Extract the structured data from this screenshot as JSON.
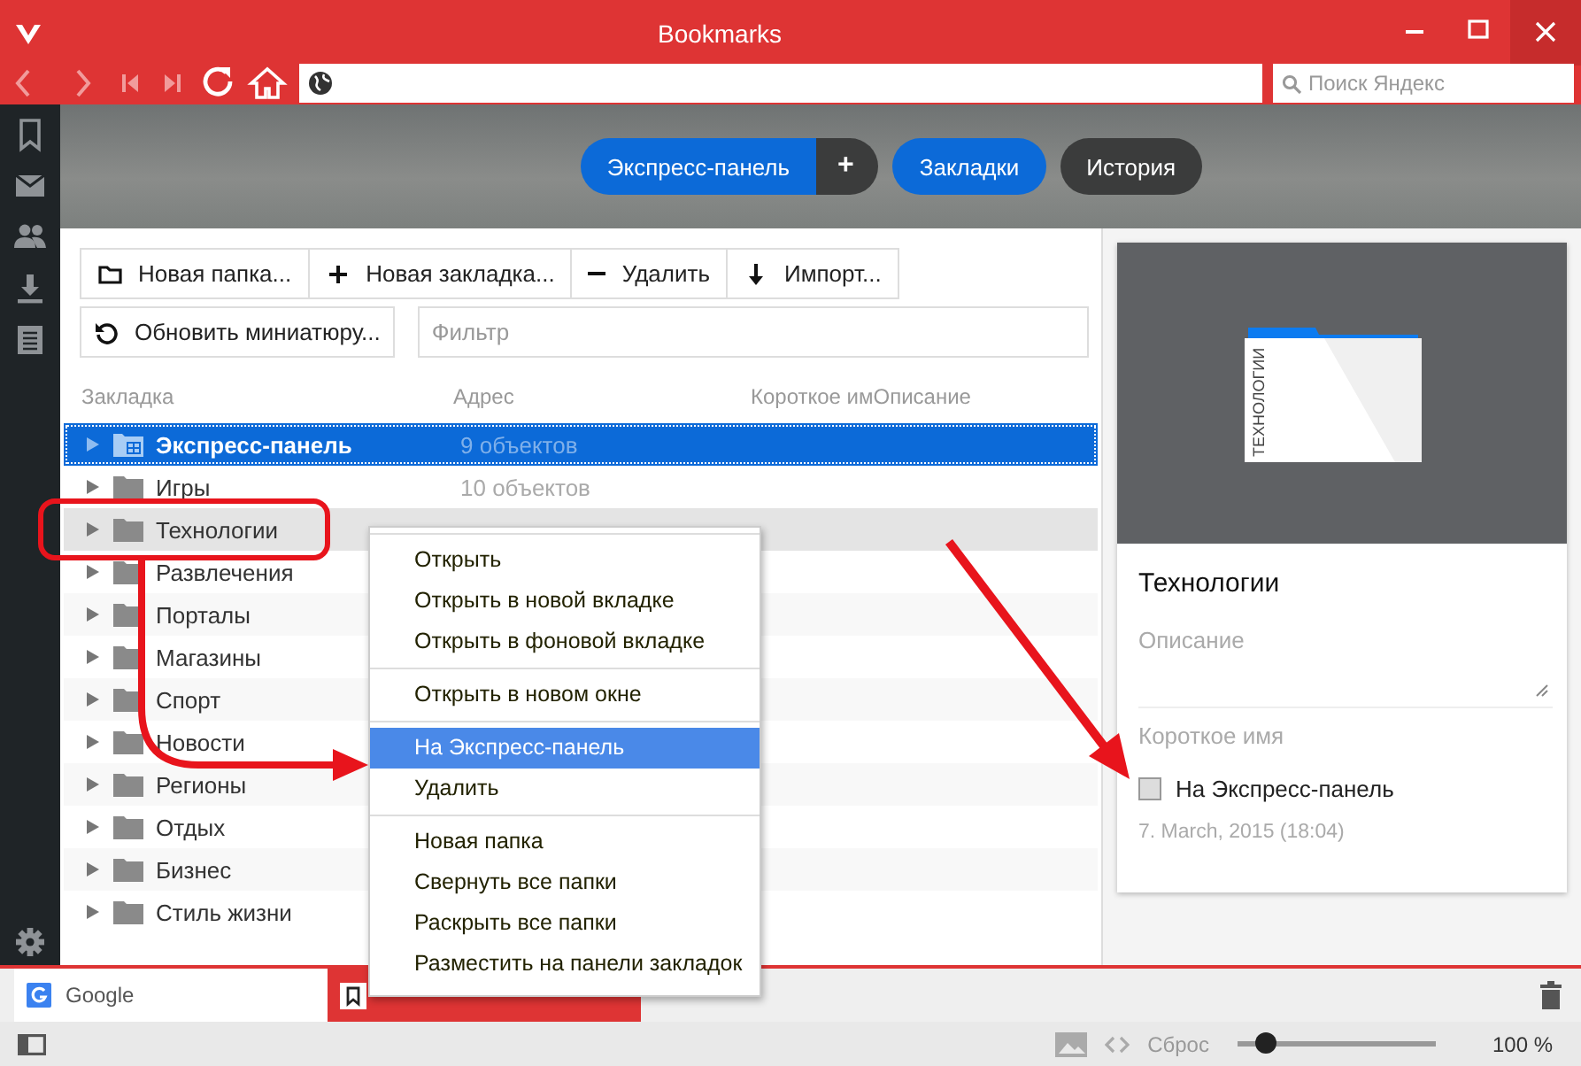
{
  "window": {
    "title": "Bookmarks"
  },
  "search": {
    "placeholder": "Поиск Яндекс"
  },
  "header_buttons": [
    {
      "label": "Экспресс-панель",
      "kind": "primary"
    },
    {
      "label": "+",
      "kind": "add"
    },
    {
      "label": "Закладки",
      "kind": "primary"
    },
    {
      "label": "История",
      "kind": "dark"
    }
  ],
  "toolbar": [
    {
      "label": "Новая папка...",
      "kind": "folder"
    },
    {
      "label": "Новая закладка...",
      "kind": "plus"
    },
    {
      "label": "Удалить",
      "kind": "minus"
    },
    {
      "label": "Импорт...",
      "kind": "import"
    }
  ],
  "refresh_button": {
    "label": "Обновить миниатюру..."
  },
  "filter": {
    "placeholder": "Фильтр"
  },
  "columns": [
    "Закладка",
    "Адрес",
    "Короткое им",
    "Описание"
  ],
  "rows": [
    {
      "name": "Экспресс-панель",
      "address": "9 объектов",
      "kind": "speeddial",
      "selected": true,
      "hovered": false
    },
    {
      "name": "Игры",
      "address": "10 объектов",
      "kind": "folder",
      "selected": false,
      "hovered": false
    },
    {
      "name": "Технологии",
      "kind": "folder",
      "selected": false,
      "hovered": true
    },
    {
      "name": "Развлечения",
      "kind": "folder",
      "selected": false,
      "hovered": false
    },
    {
      "name": "Порталы",
      "kind": "folder",
      "selected": false,
      "hovered": false
    },
    {
      "name": "Магазины",
      "kind": "folder",
      "selected": false,
      "hovered": false
    },
    {
      "name": "Спорт",
      "kind": "folder",
      "selected": false,
      "hovered": false
    },
    {
      "name": "Новости",
      "kind": "folder",
      "selected": false,
      "hovered": false
    },
    {
      "name": "Регионы",
      "kind": "folder",
      "selected": false,
      "hovered": false
    },
    {
      "name": "Отдых",
      "kind": "folder",
      "selected": false,
      "hovered": false
    },
    {
      "name": "Бизнес",
      "kind": "folder",
      "selected": false,
      "hovered": false
    },
    {
      "name": "Стиль жизни",
      "kind": "folder",
      "selected": false,
      "hovered": false
    }
  ],
  "context_menu": [
    {
      "items": [
        {
          "label": "Открыть",
          "selected": false
        },
        {
          "label": "Открыть в новой вкладке",
          "selected": false
        },
        {
          "label": "Открыть в фоновой вкладке",
          "selected": false
        }
      ]
    },
    {
      "items": [
        {
          "label": "Открыть в новом окне",
          "selected": false
        }
      ]
    },
    {
      "items": [
        {
          "label": "На Экспресс-панель",
          "selected": true
        },
        {
          "label": "Удалить",
          "selected": false
        }
      ]
    },
    {
      "items": [
        {
          "label": "Новая папка",
          "selected": false
        },
        {
          "label": "Свернуть все папки",
          "selected": false
        },
        {
          "label": "Раскрыть все папки",
          "selected": false
        },
        {
          "label": "Разместить на панели закладок",
          "selected": false
        }
      ]
    }
  ],
  "detail": {
    "thumbnail_label": "ТЕХНОЛОГИИ",
    "title": "Технологии",
    "description_placeholder": "Описание",
    "nickname_placeholder": "Короткое имя",
    "speed_dial": {
      "label": "На Экспресс-панель",
      "checked": false
    },
    "date": "7. March, 2015 (18:04)"
  },
  "tabs": [
    {
      "label": "Google",
      "kind": "google",
      "selected": false
    },
    {
      "kind": "bookmarks",
      "selected": true
    }
  ],
  "status_bar": {
    "reset": "Сброс",
    "zoom": {
      "level": 0.14,
      "reading": "100 %"
    }
  },
  "annotations": [
    {
      "kind": "outline"
    },
    {
      "kind": "arrow"
    },
    {
      "kind": "arrow"
    }
  ]
}
